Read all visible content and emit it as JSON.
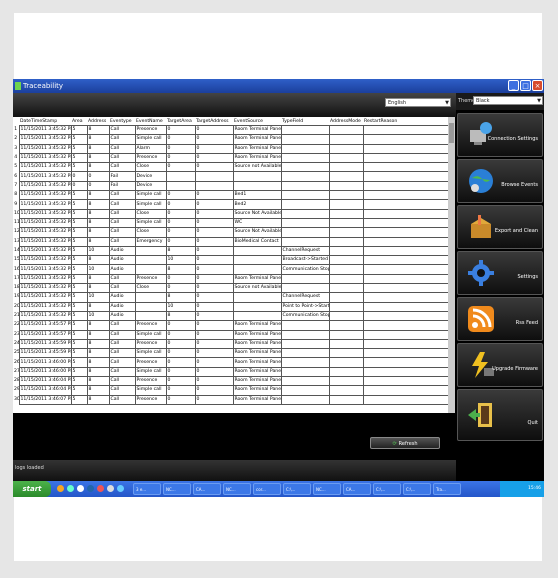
{
  "window": {
    "title": "Traceability"
  },
  "toolbar": {
    "language": "English"
  },
  "sidebar": {
    "theme_label": "Theme",
    "theme_value": "Black",
    "buttons": [
      {
        "label": "Connection Settings",
        "icon": "network-settings-icon"
      },
      {
        "label": "Browse Events",
        "icon": "globe-icon"
      },
      {
        "label": "Export and Clean",
        "icon": "box-export-icon"
      },
      {
        "label": "Settings",
        "icon": "gear-icon"
      },
      {
        "label": "Rss Feed",
        "icon": "rss-icon"
      },
      {
        "label": "Upgrade Firmware",
        "icon": "lightning-upgrade-icon"
      },
      {
        "label": "Quit",
        "icon": "exit-door-icon"
      }
    ]
  },
  "table": {
    "columns": [
      "DateTimeStamp",
      "Area",
      "Address",
      "Eventype",
      "EventName",
      "TargetArea",
      "TargetAddress",
      "EventSource",
      "TypeField",
      "AddressMode",
      "RestartReason"
    ],
    "rows": [
      [
        "1",
        "11/15/2011 3:45:32 PM",
        "5",
        "8",
        "Call",
        "Presence",
        "0",
        "0",
        "Room Terminal Panel",
        "",
        "",
        ""
      ],
      [
        "2",
        "11/15/2011 3:45:32 PM",
        "5",
        "8",
        "Call",
        "Simple call",
        "0",
        "0",
        "Room Terminal Panel",
        "",
        "",
        ""
      ],
      [
        "3",
        "11/15/2011 3:45:32 PM",
        "5",
        "8",
        "Call",
        "Alarm",
        "0",
        "0",
        "Room Terminal Panel",
        "",
        "",
        ""
      ],
      [
        "4",
        "11/15/2011 3:45:32 PM",
        "5",
        "8",
        "Call",
        "Presence",
        "0",
        "0",
        "Room Terminal Panel",
        "",
        "",
        ""
      ],
      [
        "5",
        "11/15/2011 3:45:32 PM",
        "5",
        "8",
        "Call",
        "Close",
        "0",
        "0",
        "Source not Available",
        "",
        "",
        ""
      ],
      [
        "6",
        "11/15/2011 3:45:32 PM",
        "0",
        "0",
        "Fail",
        "Device",
        "",
        "",
        "",
        "",
        "",
        ""
      ],
      [
        "7",
        "11/15/2011 3:45:32 PM",
        "0",
        "0",
        "Fail",
        "Device",
        "",
        "",
        "",
        "",
        "",
        ""
      ],
      [
        "8",
        "11/15/2011 3:45:32 PM",
        "5",
        "8",
        "Call",
        "Simple call",
        "0",
        "0",
        "Bed1",
        "",
        "",
        ""
      ],
      [
        "9",
        "11/15/2011 3:45:32 PM",
        "5",
        "8",
        "Call",
        "Simple call",
        "0",
        "0",
        "Bed2",
        "",
        "",
        ""
      ],
      [
        "10",
        "11/15/2011 3:45:32 PM",
        "5",
        "8",
        "Call",
        "Close",
        "0",
        "0",
        "Source Not Available",
        "",
        "",
        ""
      ],
      [
        "11",
        "11/15/2011 3:45:32 PM",
        "5",
        "8",
        "Call",
        "Simple call",
        "0",
        "0",
        "WC",
        "",
        "",
        ""
      ],
      [
        "12",
        "11/15/2011 3:45:32 PM",
        "5",
        "8",
        "Call",
        "Close",
        "0",
        "0",
        "Source Not Available",
        "",
        "",
        ""
      ],
      [
        "13",
        "11/15/2011 3:45:32 PM",
        "5",
        "8",
        "Call",
        "Emergency",
        "0",
        "0",
        "BioMedical Contact",
        "",
        "",
        ""
      ],
      [
        "14",
        "11/15/2011 3:45:32 PM",
        "5",
        "10",
        "Audio",
        "",
        "8",
        "0",
        "",
        "ChannelRequest",
        "",
        ""
      ],
      [
        "15",
        "11/15/2011 3:45:32 PM",
        "5",
        "8",
        "Audio",
        "",
        "10",
        "0",
        "",
        "Broadcast->Started",
        "",
        ""
      ],
      [
        "16",
        "11/15/2011 3:45:32 PM",
        "5",
        "10",
        "Audio",
        "",
        "8",
        "0",
        "",
        "Communication Stop",
        "",
        ""
      ],
      [
        "17",
        "11/15/2011 3:45:32 PM",
        "5",
        "8",
        "Call",
        "Presence",
        "0",
        "0",
        "Room Terminal Panel",
        "",
        "",
        ""
      ],
      [
        "18",
        "11/15/2011 3:45:32 PM",
        "5",
        "8",
        "Call",
        "Close",
        "0",
        "0",
        "Source not Available",
        "",
        "",
        ""
      ],
      [
        "19",
        "11/15/2011 3:45:32 PM",
        "5",
        "10",
        "Audio",
        "",
        "8",
        "0",
        "",
        "ChannelRequest",
        "",
        ""
      ],
      [
        "20",
        "11/15/2011 3:45:32 PM",
        "5",
        "8",
        "Audio",
        "",
        "10",
        "0",
        "",
        "Point to Point->Started",
        "",
        ""
      ],
      [
        "21",
        "11/15/2011 3:45:32 PM",
        "5",
        "10",
        "Audio",
        "",
        "8",
        "0",
        "",
        "Communication Stop",
        "",
        ""
      ],
      [
        "22",
        "11/15/2011 3:45:57 PM",
        "5",
        "8",
        "Call",
        "Presence",
        "0",
        "0",
        "Room Terminal Panel",
        "",
        "",
        ""
      ],
      [
        "23",
        "11/15/2011 3:45:57 PM",
        "5",
        "8",
        "Call",
        "Simple call",
        "0",
        "0",
        "Room Terminal Panel",
        "",
        "",
        ""
      ],
      [
        "24",
        "11/15/2011 3:45:59 PM",
        "5",
        "8",
        "Call",
        "Presence",
        "0",
        "0",
        "Room Terminal Panel",
        "",
        "",
        ""
      ],
      [
        "25",
        "11/15/2011 3:45:59 PM",
        "5",
        "8",
        "Call",
        "Simple call",
        "0",
        "0",
        "Room Terminal Panel",
        "",
        "",
        ""
      ],
      [
        "26",
        "11/15/2011 3:46:00 PM",
        "5",
        "8",
        "Call",
        "Presence",
        "0",
        "0",
        "Room Terminal Panel",
        "",
        "",
        ""
      ],
      [
        "27",
        "11/15/2011 3:46:00 PM",
        "5",
        "8",
        "Call",
        "Simple call",
        "0",
        "0",
        "Room Terminal Panel",
        "",
        "",
        ""
      ],
      [
        "28",
        "11/15/2011 3:46:04 PM",
        "5",
        "8",
        "Call",
        "Presence",
        "0",
        "0",
        "Room Terminal Panel",
        "",
        "",
        ""
      ],
      [
        "29",
        "11/15/2011 3:46:04 PM",
        "5",
        "8",
        "Call",
        "Simple call",
        "0",
        "0",
        "Room Terminal Panel",
        "",
        "",
        ""
      ],
      [
        "30",
        "11/15/2011 3:46:07 PM",
        "5",
        "8",
        "Call",
        "Presence",
        "0",
        "0",
        "Room Terminal Panel",
        "",
        "",
        ""
      ]
    ]
  },
  "refresh_label": "Refresh",
  "status": {
    "text": "logs loaded"
  },
  "taskbar": {
    "start_label": "start",
    "buttons": [
      "3 e...",
      "NC...",
      "CA...",
      "NC...",
      "cor...",
      "C:\\...",
      "NC...",
      "CA...",
      "C:\\...",
      "C:\\...",
      "Tra..."
    ],
    "clock": "15:46"
  },
  "colors": {
    "accent": "#2456c9",
    "start": "#3fa33d",
    "background": "#000000"
  }
}
